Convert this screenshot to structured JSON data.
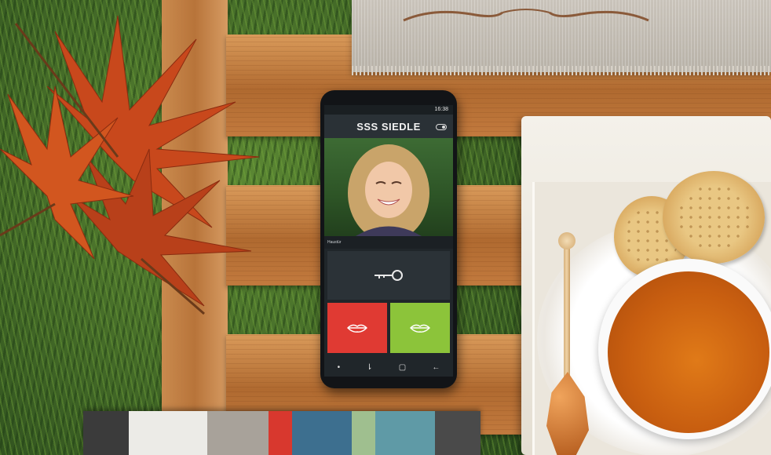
{
  "phone": {
    "status_time": "16:38",
    "app_brand": "SSS SIEDLE",
    "video_caption": "Haustür",
    "icons": {
      "toggle": "toggle-icon",
      "key": "key-icon",
      "reject": "lips-icon",
      "accept": "lips-icon",
      "nav_back": "back-icon",
      "nav_home": "home-icon",
      "nav_recent": "recent-icon",
      "nav_dot": "dot-icon"
    },
    "colors": {
      "reject_button": "#e03a33",
      "accept_button": "#8cc43a"
    }
  },
  "swatches": [
    "#3b3b3b",
    "#ecebe7",
    "#a8a29a",
    "#d8382e",
    "#3d6f8f",
    "#9fbf8f",
    "#5f9aa6",
    "#4a4a4a"
  ]
}
